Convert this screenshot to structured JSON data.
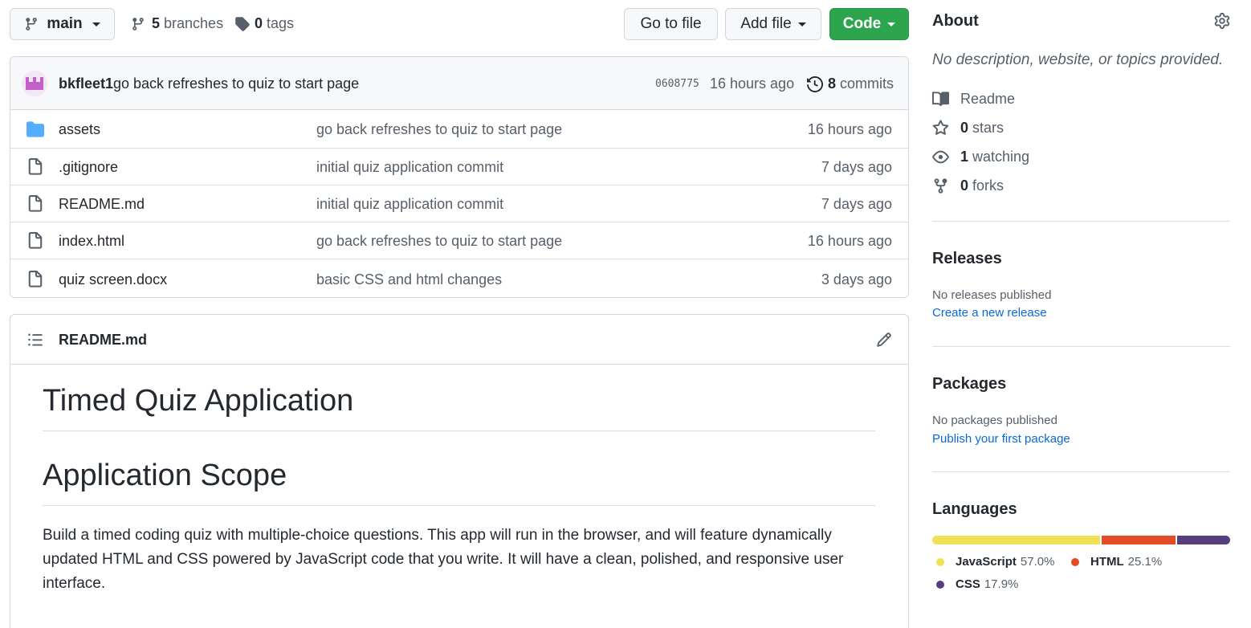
{
  "toolbar": {
    "branch": "main",
    "branches_count": "5",
    "branches_label": "branches",
    "tags_count": "0",
    "tags_label": "tags",
    "go_to_file": "Go to file",
    "add_file": "Add file",
    "code": "Code"
  },
  "commit": {
    "author": "bkfleet1",
    "message": "go back refreshes to quiz to start page",
    "sha": "0608775",
    "time": "16 hours ago",
    "commits_count": "8",
    "commits_label": "commits"
  },
  "files": [
    {
      "name": "assets",
      "type": "folder",
      "message": "go back refreshes to quiz to start page",
      "age": "16 hours ago"
    },
    {
      "name": ".gitignore",
      "type": "file",
      "message": "initial quiz application commit",
      "age": "7 days ago"
    },
    {
      "name": "README.md",
      "type": "file",
      "message": "initial quiz application commit",
      "age": "7 days ago"
    },
    {
      "name": "index.html",
      "type": "file",
      "message": "go back refreshes to quiz to start page",
      "age": "16 hours ago"
    },
    {
      "name": "quiz screen.docx",
      "type": "file",
      "message": "basic CSS and html changes",
      "age": "3 days ago"
    }
  ],
  "readme": {
    "filename": "README.md",
    "h1": "Timed Quiz Application",
    "h2": "Application Scope",
    "paragraph": "Build a timed coding quiz with multiple-choice questions. This app will run in the browser, and will feature dynamically updated HTML and CSS powered by JavaScript code that you write. It will have a clean, polished, and responsive user interface."
  },
  "about": {
    "title": "About",
    "description": "No description, website, or topics provided.",
    "readme_label": "Readme",
    "stars_count": "0",
    "stars_label": "stars",
    "watching_count": "1",
    "watching_label": "watching",
    "forks_count": "0",
    "forks_label": "forks"
  },
  "releases": {
    "title": "Releases",
    "empty": "No releases published",
    "link": "Create a new release"
  },
  "packages": {
    "title": "Packages",
    "empty": "No packages published",
    "link": "Publish your first package"
  },
  "languages": {
    "title": "Languages",
    "items": [
      {
        "name": "JavaScript",
        "percent": "57.0%",
        "value": 57.0,
        "color": "#f1e05a"
      },
      {
        "name": "HTML",
        "percent": "25.1%",
        "value": 25.1,
        "color": "#e34c26"
      },
      {
        "name": "CSS",
        "percent": "17.9%",
        "value": 17.9,
        "color": "#563d7c"
      }
    ]
  },
  "colors": {
    "accent": "#0969da",
    "primary_button": "#2da44e",
    "folder_icon": "#54aeff"
  }
}
